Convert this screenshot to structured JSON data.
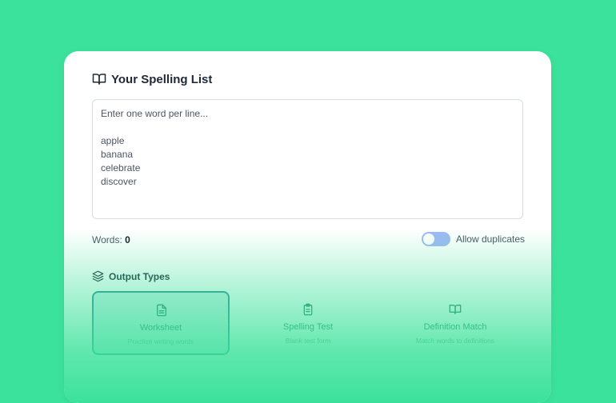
{
  "header": {
    "title": "Your Spelling List",
    "icon": "book-open-icon"
  },
  "word_input": {
    "placeholder": "Enter one word per line...",
    "lines": [
      "apple",
      "banana",
      "celebrate",
      "discover"
    ]
  },
  "stats": {
    "words_label": "Words:",
    "words_count": "0"
  },
  "duplicates_toggle": {
    "label": "Allow duplicates",
    "on": true
  },
  "output_section": {
    "title": "Output Types",
    "icon": "layers-icon",
    "types": [
      {
        "label": "Worksheet",
        "description": "Practice writing words",
        "icon": "document-icon",
        "selected": true
      },
      {
        "label": "Spelling Test",
        "description": "Blank test form",
        "icon": "clipboard-icon",
        "selected": false
      },
      {
        "label": "Definition Match",
        "description": "Match words to definitions",
        "icon": "book-open-icon",
        "selected": false
      }
    ]
  },
  "colors": {
    "background": "#3be29b",
    "toggle": "#9fb9f5",
    "selected_border": "#2f8f92"
  }
}
